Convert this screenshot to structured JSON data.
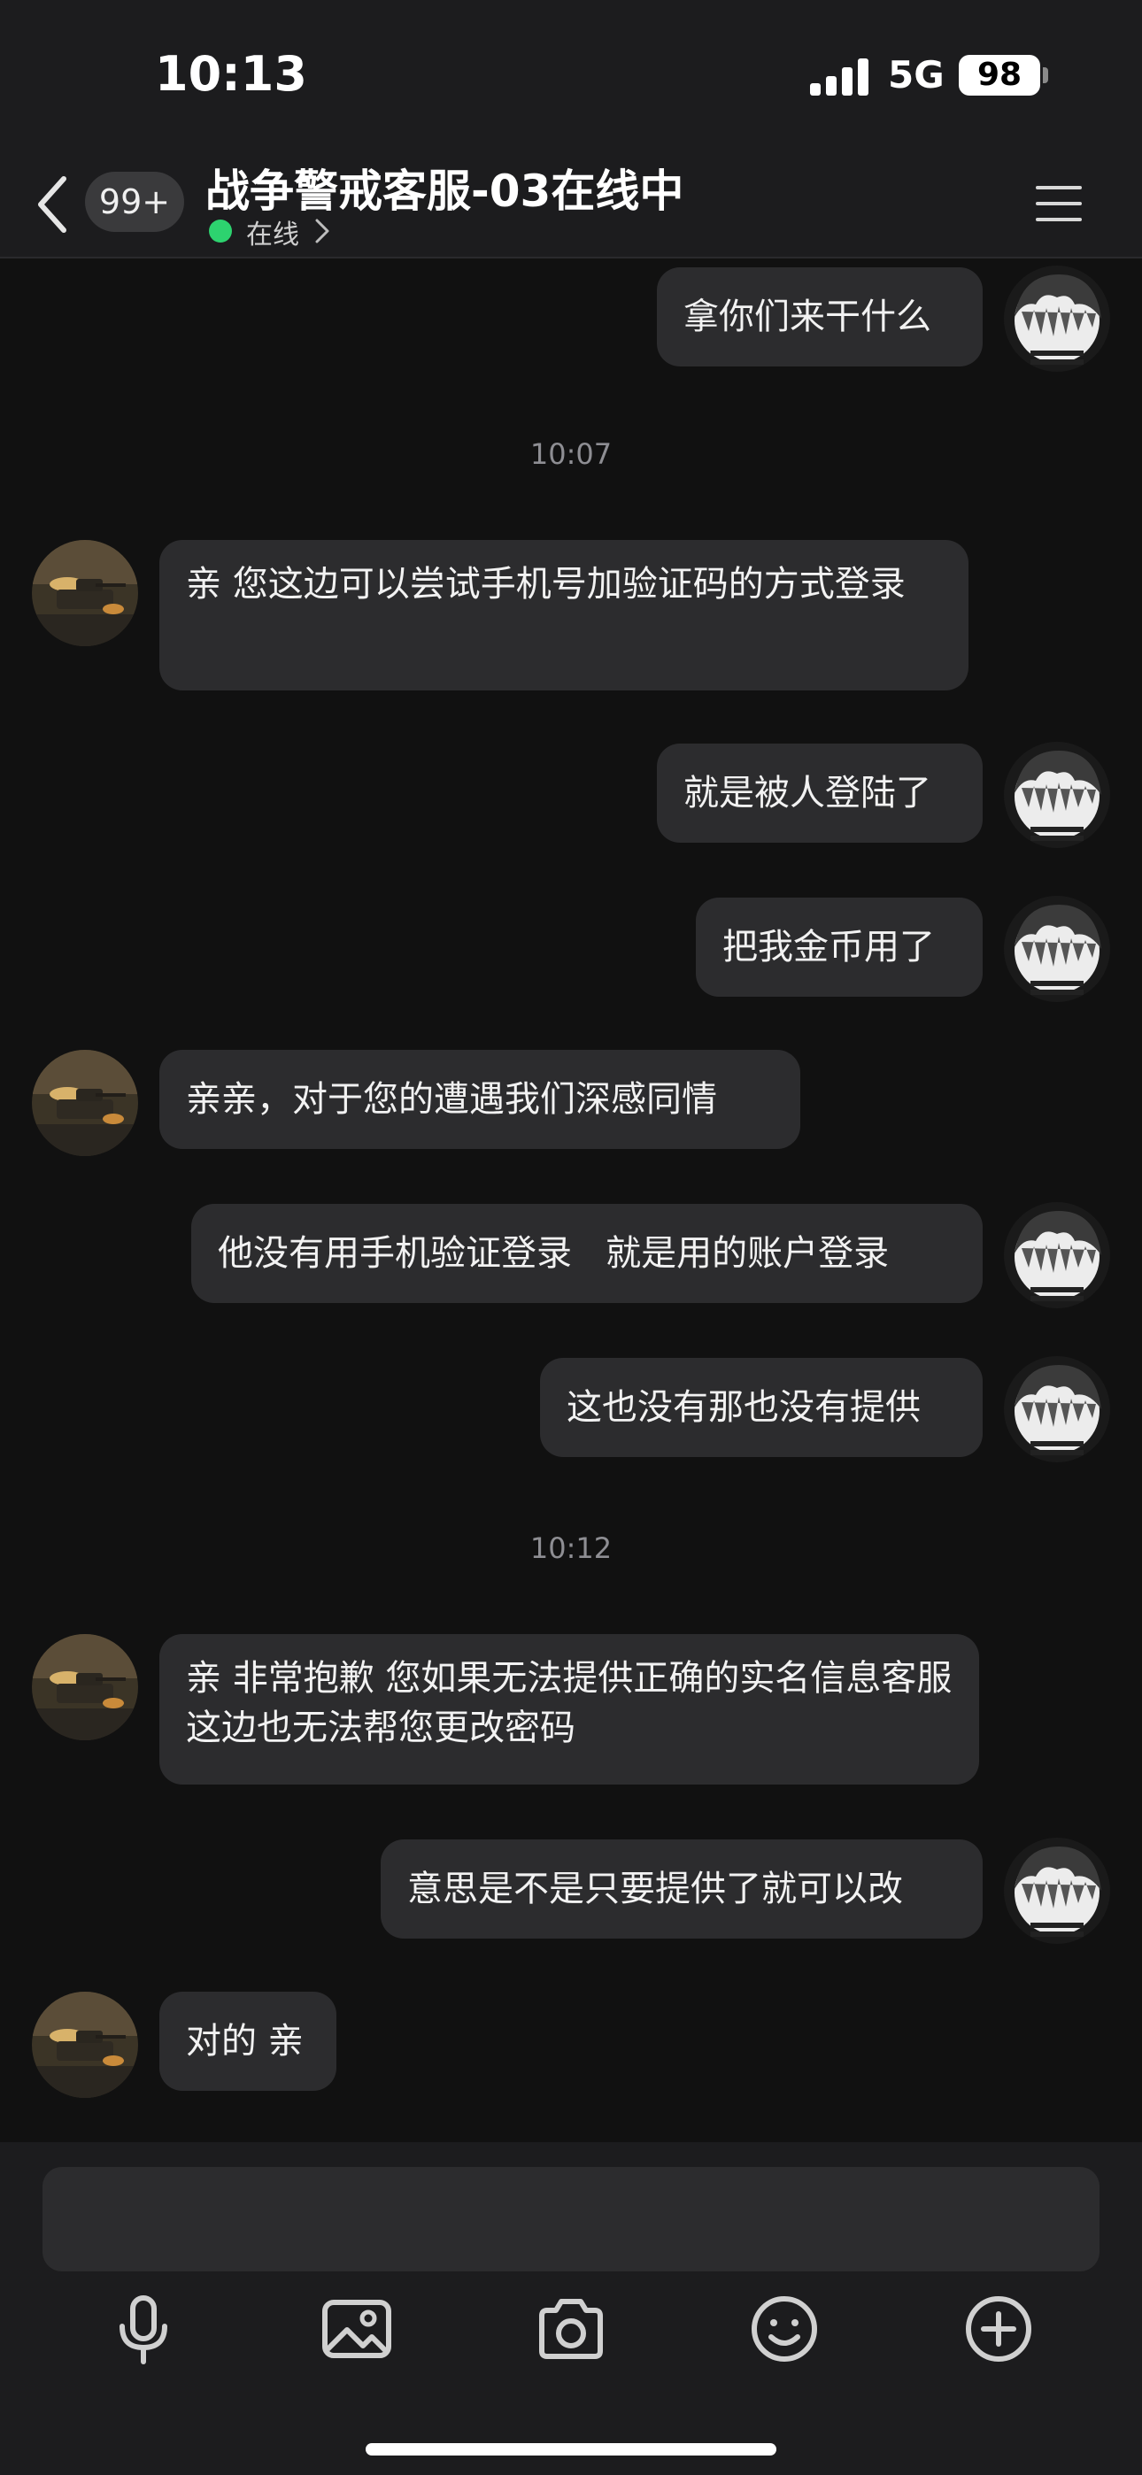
{
  "status_bar": {
    "time": "10:13",
    "network": "5G",
    "battery": "98"
  },
  "header": {
    "back_badge": "99+",
    "title": "战争警戒客服-03在线中",
    "presence": "在线",
    "presence_color": "#2dd36f"
  },
  "messages": [
    {
      "side": "out",
      "text": "拿你们来干什么"
    },
    {
      "type": "time",
      "text": "10:07"
    },
    {
      "side": "in",
      "text": "亲 您这边可以尝试手机号加验证码的方式登录"
    },
    {
      "side": "out",
      "text": "就是被人登陆了"
    },
    {
      "side": "out",
      "text": "把我金币用了"
    },
    {
      "side": "in",
      "text": "亲亲，对于您的遭遇我们深感同情"
    },
    {
      "side": "out",
      "text": "他没有用手机验证登录   就是用的账户登录"
    },
    {
      "side": "out",
      "text": "这也没有那也没有提供"
    },
    {
      "type": "time",
      "text": "10:12"
    },
    {
      "side": "in",
      "text": "亲 非常抱歉 您如果无法提供正确的实名信息客服这边也无法帮您更改密码"
    },
    {
      "side": "out",
      "text": "意思是不是只要提供了就可以改"
    },
    {
      "side": "in",
      "text": "对的 亲"
    }
  ],
  "composer": {
    "value": "",
    "placeholder": ""
  },
  "toolbar": {
    "icons": [
      "microphone-icon",
      "image-icon",
      "camera-icon",
      "emoji-icon",
      "plus-icon"
    ]
  },
  "colors": {
    "background": "#111111",
    "bubble": "#2c2c2e",
    "bar": "#1c1c1e"
  }
}
